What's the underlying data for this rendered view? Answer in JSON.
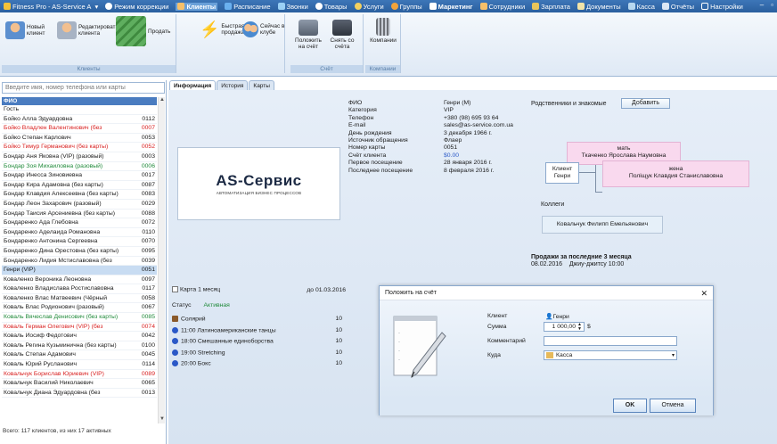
{
  "menu": {
    "app_title": "Fitness Pro - AS-Service A",
    "correction": "Режим коррекции",
    "items": [
      "Клиенты",
      "Расписание",
      "Звонки",
      "Товары",
      "Услуги",
      "Группы",
      "Маркетинг",
      "Сотрудники",
      "Зарплата",
      "Документы",
      "Касса",
      "Отчёты",
      "Настройки"
    ],
    "active": "Клиенты",
    "controls": [
      "–",
      "▫"
    ]
  },
  "ribbon": {
    "new_client": "Новый клиент",
    "edit_client": "Редактировать клиента",
    "sell": "Продать",
    "quick_sale": "Быстрая продажа",
    "now_in_club": "Сейчас в клубе",
    "group_clients": "Клиенты",
    "deposit": "Положить на счёт",
    "withdraw": "Снять со счёта",
    "group_account": "Счёт",
    "companies": "Компании",
    "group_companies": "Компании"
  },
  "left": {
    "search_placeholder": "Введите имя, номер телефона или карты",
    "col_name": "ФИО",
    "clients": [
      {
        "n": "Гость",
        "c": ""
      },
      {
        "n": "Бойко Алла Эдуардовна",
        "c": "0112"
      },
      {
        "n": "Бойко Владлен Валентинович (без",
        "c": "0007"
      },
      {
        "n": "Бойко Степан Карлович",
        "c": "0053"
      },
      {
        "n": "Бойко Тимур Германович (без карты)",
        "c": "0052"
      },
      {
        "n": "Бондар Аня Яковна (VIP) (разовый)",
        "c": "0003"
      },
      {
        "n": "Бондар Зоя Михаиловна (разовый)",
        "c": "0006"
      },
      {
        "n": "Бондар Инесса Зиновиевна",
        "c": "0017"
      },
      {
        "n": "Бондар Кира Адамовна (без карты)",
        "c": "0087"
      },
      {
        "n": "Бондар Клавдия Алексеевна (без карты)",
        "c": "0083"
      },
      {
        "n": "Бондар Леон Захарович (разовый)",
        "c": "0029"
      },
      {
        "n": "Бондар Таисия Арсениевна (без карты)",
        "c": "0088"
      },
      {
        "n": "Бондаренко Ада Глебовна",
        "c": "0072"
      },
      {
        "n": "Бондаренко Аделаида Романовна",
        "c": "0110"
      },
      {
        "n": "Бондаренко Антонина Сергеевна",
        "c": "0070"
      },
      {
        "n": "Бондаренко Дина Орестовна (без карты)",
        "c": "0095"
      },
      {
        "n": "Бондаренко Лидия Мстиславовна (без",
        "c": "0039"
      },
      {
        "n": "Генри (VIP)",
        "c": "0051"
      },
      {
        "n": "Коваленко Вероника Леоновна",
        "c": "0097"
      },
      {
        "n": "Коваленко Владислава Ростиславовна",
        "c": "0117"
      },
      {
        "n": "Коваленко Влас Матвеевич (Чёрный",
        "c": "0058"
      },
      {
        "n": "Коваль Влас Родионович (разовый)",
        "c": "0067"
      },
      {
        "n": "Коваль Вячеслав Денисович (без карты)",
        "c": "0085"
      },
      {
        "n": "Коваль Герман Олегович (VIP) (без",
        "c": "0074"
      },
      {
        "n": "Коваль Иосиф Федотович",
        "c": "0042"
      },
      {
        "n": "Коваль Регина Кузьминична (без карты)",
        "c": "0100"
      },
      {
        "n": "Коваль Степан Адамович",
        "c": "0045"
      },
      {
        "n": "Коваль Юрий Русланович",
        "c": "0114"
      },
      {
        "n": "Ковальчук Борислав Юриевич (VIP)",
        "c": "0089"
      },
      {
        "n": "Ковальчук Василий Николаевич",
        "c": "0065"
      },
      {
        "n": "Ковальчук Диана Эдуардовна (без",
        "c": "0013"
      }
    ],
    "footer": "Всего: 117 клиентов, из них 17 активных"
  },
  "tabs": [
    "Информация",
    "История",
    "Карты"
  ],
  "logo": {
    "name": "AS-Сервис",
    "tagline": "АВТОМАТИЗАЦИЯ БИЗНЕС ПРОЦЕССОВ"
  },
  "info": {
    "labels": [
      "ФИО",
      "Категория",
      "Телефон",
      "E-mail",
      "День рождения",
      "Источник обращения",
      "Номер карты",
      "Счёт клиента",
      "Первое посещение",
      "Последнее посещение"
    ],
    "values": [
      "Генри (M)",
      "VIP",
      "+380 (98) 695 93 64",
      "sales@as-service.com.ua",
      "3 декабря 1966 г.",
      "Флаер",
      "0051",
      "$0.00",
      "28 января 2016 г.",
      "8 февраля 2016 г."
    ]
  },
  "relatives": {
    "title": "Родственники и знакомые",
    "add": "Добавить",
    "mother": "мать\nТкаченко Ярослава Наумовна",
    "client": "Клиент\nГенри",
    "wife": "жена\nПоліщук Клавдия Станиславовна",
    "colleagues_title": "Коллеги",
    "colleague": "Ковальчук Филипп Емельянович"
  },
  "sales": {
    "title": "Продажи за последние 3 месяца",
    "entry": "08.02.2016    Джиу-джитсу 10:00"
  },
  "card": {
    "name": "Карта 1 месяц",
    "until": "до 01.03.2016",
    "status_label": "Статус",
    "status_value": "Активная",
    "services": [
      {
        "n": "Солярий",
        "q": "10"
      },
      {
        "n": "11:00 Латиноамериканские танцы",
        "q": "10"
      },
      {
        "n": "18:00 Смешанные единоборства",
        "q": "10"
      },
      {
        "n": "19:00 Stretching",
        "q": "10"
      },
      {
        "n": "20:00 Бокс",
        "q": "10"
      }
    ]
  },
  "dialog": {
    "title": "Положить на счёт",
    "close": "✕",
    "client_label": "Клиент",
    "client_value": "Генри",
    "sum_label": "Сумма",
    "sum_value": "1 000,00",
    "currency": "$",
    "comment_label": "Комментарий",
    "comment_value": "",
    "where_label": "Куда",
    "where_value": "Касса",
    "ok": "OK",
    "cancel": "Отмена"
  }
}
